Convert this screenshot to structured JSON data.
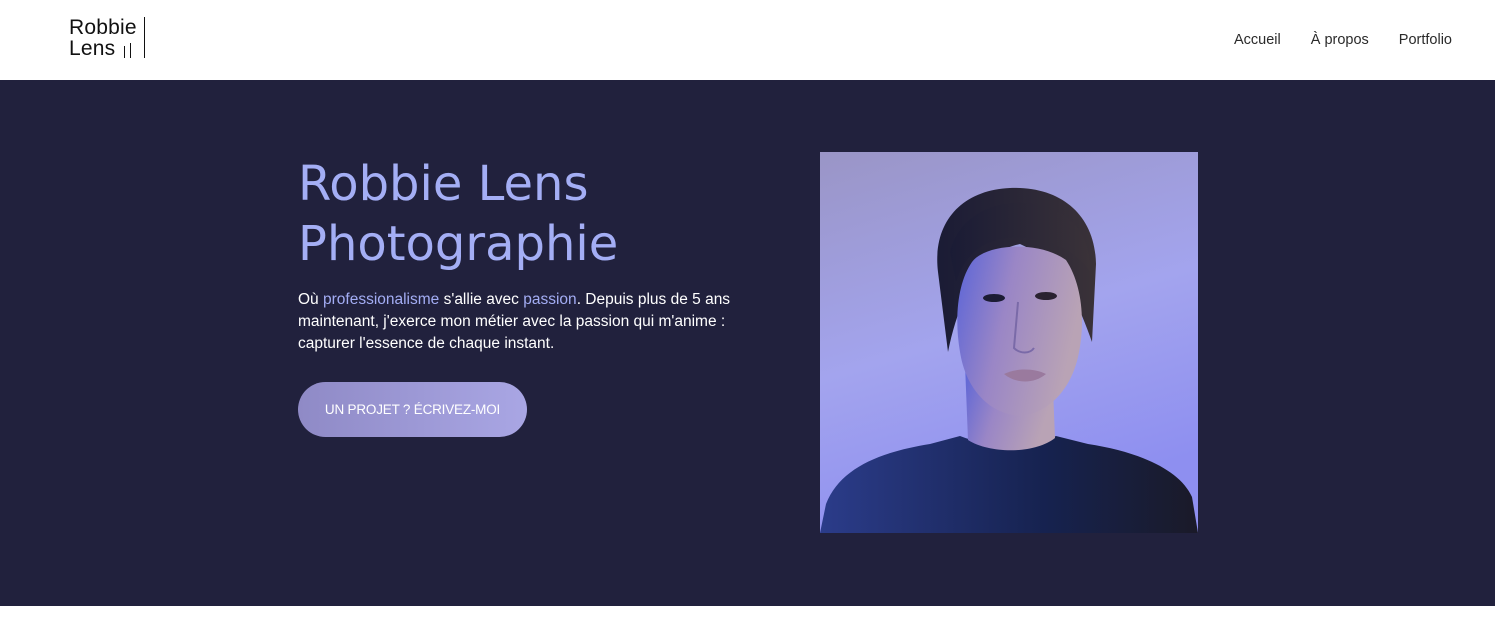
{
  "brand": {
    "logo_line1": "Robbie",
    "logo_line2": "Lens"
  },
  "nav": {
    "items": [
      "Accueil",
      "À propos",
      "Portfolio"
    ]
  },
  "hero": {
    "title_line1": "Robbie Lens",
    "title_line2": "Photographie",
    "text": {
      "part1": "Où ",
      "highlight1": "professionalisme",
      "part2": " s'allie avec ",
      "highlight2": "passion",
      "part3": ". Depuis plus de 5 ans maintenant, j'exerce mon métier avec la passion qui m'anime : capturer l'essence de chaque instant."
    },
    "cta_label": "UN PROJET ? ÉCRIVEZ-MOI"
  },
  "colors": {
    "hero_background": "#21213d",
    "accent": "#a4aef5",
    "button": "#9d99d6"
  }
}
